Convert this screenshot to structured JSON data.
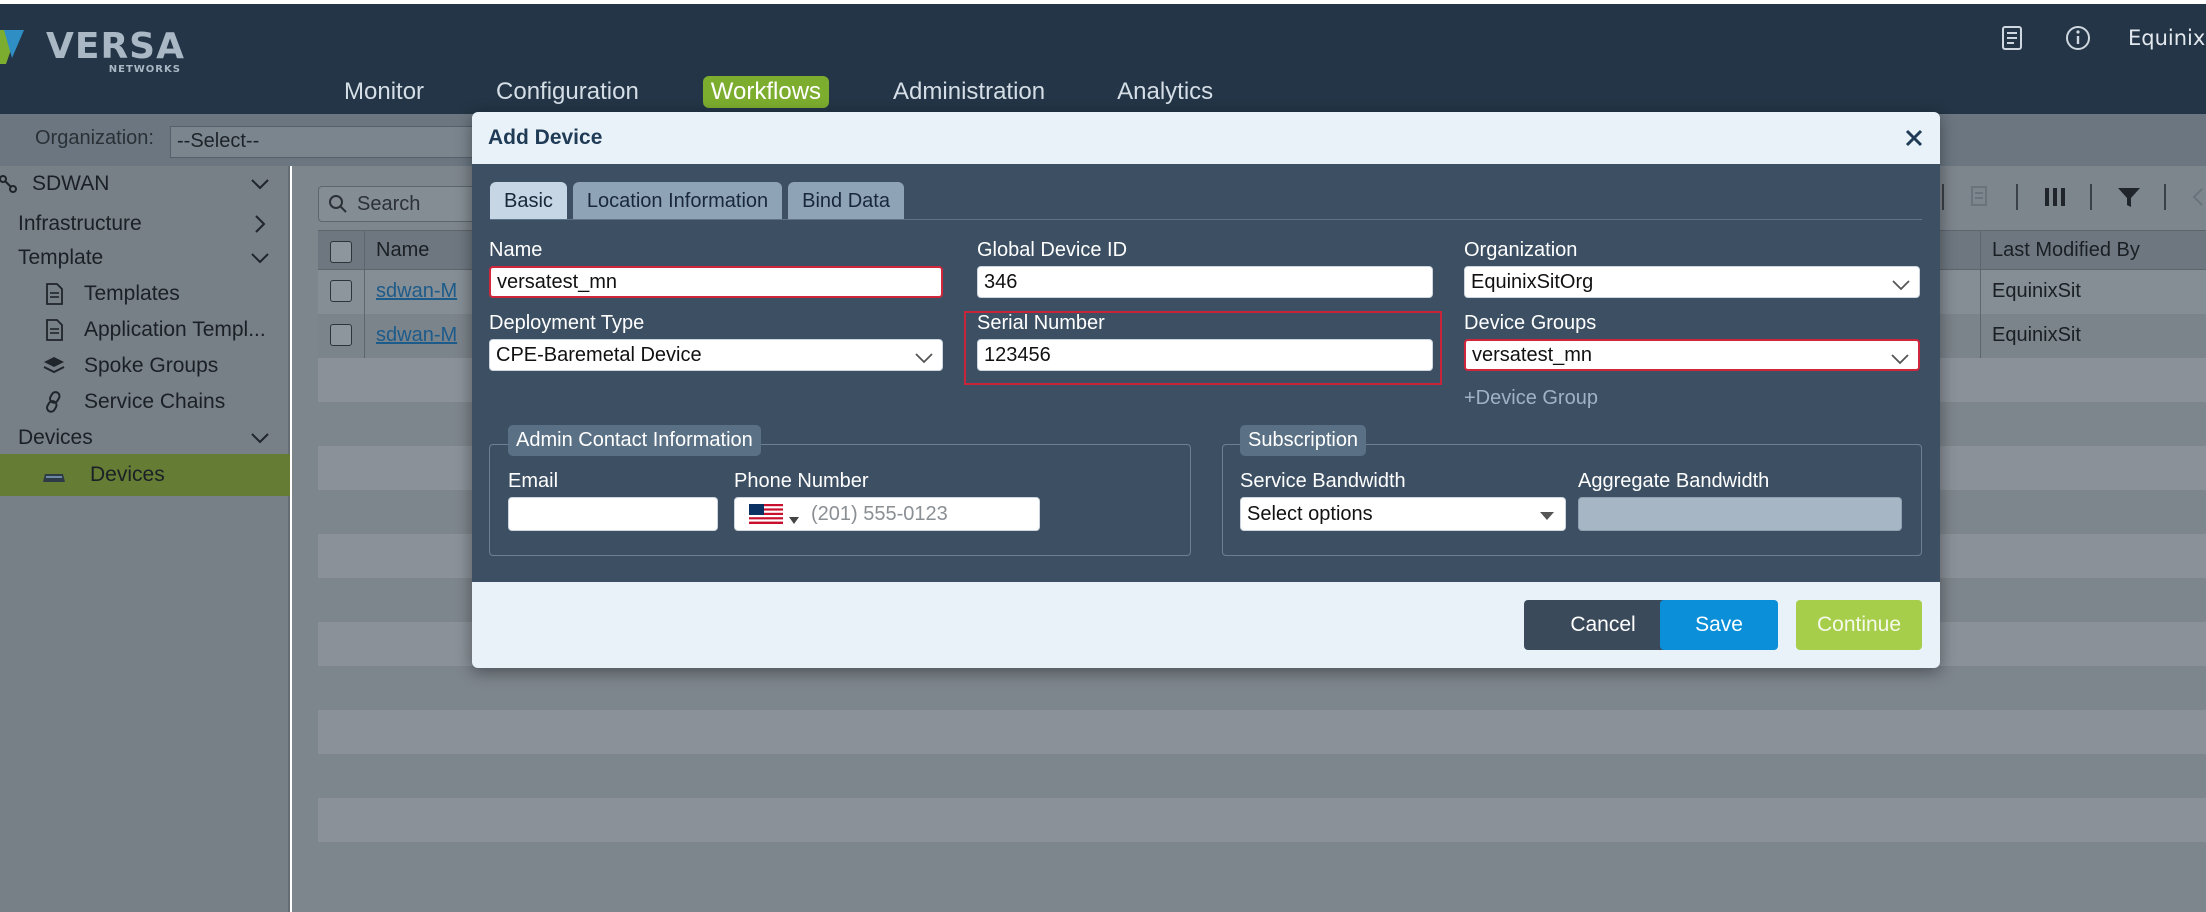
{
  "brand": {
    "name": "VERSA",
    "sub": "NETWORKS"
  },
  "header": {
    "user": "EquinixSit",
    "icons": [
      "document-icon",
      "info-icon"
    ]
  },
  "nav": [
    {
      "label": "Monitor",
      "active": false
    },
    {
      "label": "Configuration",
      "active": false
    },
    {
      "label": "Workflows",
      "active": true
    },
    {
      "label": "Administration",
      "active": false
    },
    {
      "label": "Analytics",
      "active": false
    }
  ],
  "orgbar": {
    "label": "Organization:",
    "value": "--Select--"
  },
  "sidebar": {
    "root": "SDWAN",
    "infrastructure": "Infrastructure",
    "template": "Template",
    "templates": "Templates",
    "app_templates": "Application Templ...",
    "spoke_groups": "Spoke Groups",
    "service_chains": "Service Chains",
    "devices_group": "Devices",
    "devices": "Devices"
  },
  "main": {
    "search_placeholder": "Search",
    "columns": {
      "name": "Name",
      "last_modified_by": "Last Modified By"
    },
    "rows": [
      {
        "name": "sdwan-M",
        "last_modified_by": "EquinixSit"
      },
      {
        "name": "sdwan-M",
        "last_modified_by": "EquinixSit"
      }
    ]
  },
  "modal": {
    "title": "Add Device",
    "tabs": [
      "Basic",
      "Location Information",
      "Bind Data"
    ],
    "fields": {
      "name_label": "Name",
      "name_value": "versatest_mn",
      "global_id_label": "Global Device ID",
      "global_id_value": "346",
      "org_label": "Organization",
      "org_value": "EquinixSitOrg",
      "deploy_label": "Deployment Type",
      "deploy_value": "CPE-Baremetal Device",
      "serial_label": "Serial Number",
      "serial_value": "123456",
      "groups_label": "Device Groups",
      "groups_value": "versatest_mn",
      "add_group": "+Device Group"
    },
    "admin": {
      "legend": "Admin Contact Information",
      "email_label": "Email",
      "phone_label": "Phone Number",
      "phone_placeholder": "(201) 555-0123"
    },
    "subscription": {
      "legend": "Subscription",
      "service_label": "Service Bandwidth",
      "service_value": "Select options",
      "aggregate_label": "Aggregate Bandwidth"
    },
    "buttons": {
      "cancel": "Cancel",
      "save": "Save",
      "continue": "Continue"
    }
  },
  "colors": {
    "header": "#233546",
    "accent": "#7cad2e",
    "save": "#0a8fd8",
    "continue": "#a6ce4b",
    "error": "#d0263b"
  }
}
